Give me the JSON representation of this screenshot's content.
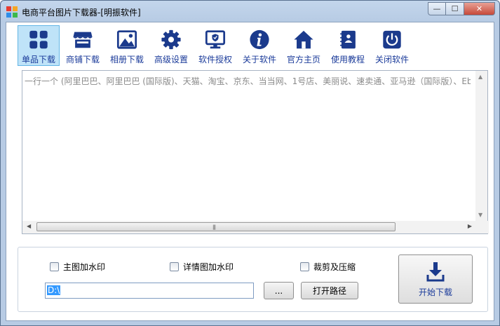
{
  "window": {
    "title": "电商平台图片下载器-[明振软件]",
    "min_label": "—",
    "max_label": "☐",
    "close_label": "✕"
  },
  "toolbar": {
    "items": [
      {
        "label": "单品下载",
        "icon": "grid-icon",
        "active": true
      },
      {
        "label": "商铺下载",
        "icon": "store-icon"
      },
      {
        "label": "相册下载",
        "icon": "image-icon"
      },
      {
        "label": "高级设置",
        "icon": "gear-icon"
      },
      {
        "label": "软件授权",
        "icon": "monitor-shield-icon"
      },
      {
        "label": "关于软件",
        "icon": "info-icon"
      },
      {
        "label": "官方主页",
        "icon": "home-icon"
      },
      {
        "label": "使用教程",
        "icon": "manual-icon"
      },
      {
        "label": "关闭软件",
        "icon": "power-icon"
      }
    ],
    "icon_color": "#1b3a8c",
    "active_bg": "#bfe3f8"
  },
  "main": {
    "placeholder": "一行一个 (阿里巴巴、阿里巴巴 (国际版)、天猫、淘宝、京东、当当网、1号店、美丽说、速卖通、亚马逊（国际版）、Eb"
  },
  "options": {
    "watermark_main": "主图加水印",
    "watermark_detail": "详情图加水印",
    "crop_compress": "裁剪及压缩",
    "path_value": "D:\\",
    "browse_label": "...",
    "open_path_label": "打开路径",
    "start_label": "开始下载"
  }
}
